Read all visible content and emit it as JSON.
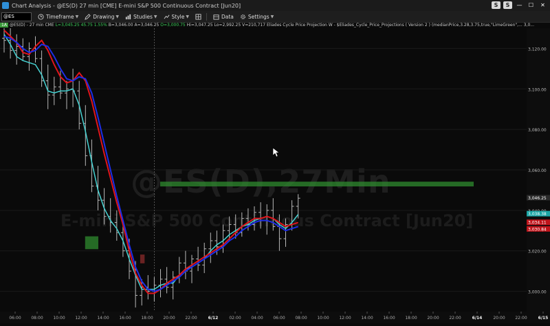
{
  "window": {
    "title": "Chart Analysis - @ES(D) 27 min [CME] E-mini S&P 500 Continuous Contract [Jun20]",
    "btn_s1": "S",
    "btn_s2": "S",
    "btn_min": "—",
    "btn_max": "☐",
    "btn_close": "✕"
  },
  "toolbar": {
    "symbol": "@ES",
    "timeframe": "Timeframe",
    "drawing": "Drawing",
    "studies": "Studies",
    "style": "Style",
    "data": "Data",
    "settings": "Settings"
  },
  "infobar": {
    "tag": "1A",
    "symbol": "@ES(D) - 27 min  CME",
    "last": "L=3,045.25",
    "change": "45.75",
    "pct": "1.55%",
    "bid": "B=3,046.00",
    "ask": "A=3,046.25",
    "open": "O=3,000.75",
    "high": "Hi=3,047.25",
    "low": "Lo=2,992.25",
    "volume": "V=210,717",
    "study": "Eliades Cycle Price Projection W - $Eliades_Cycle_Price_Projections ( Version 2 ) (medianPrice,3.28,3.75,true,\"LimeGreen\",... 3,0..."
  },
  "watermark": {
    "line1": "@ES(D),27Min",
    "line2": "E-mini S&P 500 Continuous Contract [Jun20]"
  },
  "colors": {
    "bars": "#b9b9b9",
    "cyan": "#46d3d3",
    "red": "#e0151c",
    "blue": "#1e2ee6",
    "zone_green": "#2f8a2f",
    "zone_red": "#8a2a2a"
  },
  "chart_data": {
    "type": "line",
    "title": "",
    "ylim": [
      2990,
      3130
    ],
    "yticks": [
      "3,120.00",
      "3,100.00",
      "3,080.00",
      "3,060.00",
      "3,040.00",
      "3,020.00",
      "3,000.00"
    ],
    "ytick_values": [
      3120,
      3100,
      3080,
      3060,
      3040,
      3020,
      3000
    ],
    "xticks": [
      "06:00",
      "08:00",
      "10:00",
      "12:00",
      "14:00",
      "16:00",
      "18:00",
      "20:00",
      "22:00",
      "6/12",
      "02:00",
      "04:00",
      "06:00",
      "08:00",
      "10:00",
      "12:00",
      "14:00",
      "16:00",
      "18:00",
      "20:00",
      "22:00",
      "6/14",
      "20:00",
      "22:00",
      "6/15"
    ],
    "price_labels": [
      {
        "text": "3,046.25",
        "value": 3046.25,
        "color": "#2a2a2a"
      },
      {
        "text": "3,038.38",
        "value": 3038.38,
        "color": "#1aa5a5"
      },
      {
        "text": "3,034.11",
        "value": 3034.11,
        "color": "#c0141b"
      },
      {
        "text": "3,030.84",
        "value": 3030.84,
        "color": "#c0141b"
      }
    ],
    "bars": [
      {
        "o": 3125,
        "h": 3131,
        "l": 3118,
        "c": 3124
      },
      {
        "o": 3124,
        "h": 3130,
        "l": 3115,
        "c": 3119
      },
      {
        "o": 3119,
        "h": 3127,
        "l": 3112,
        "c": 3121
      },
      {
        "o": 3121,
        "h": 3125,
        "l": 3114,
        "c": 3116
      },
      {
        "o": 3116,
        "h": 3123,
        "l": 3109,
        "c": 3120
      },
      {
        "o": 3120,
        "h": 3126,
        "l": 3113,
        "c": 3115
      },
      {
        "o": 3115,
        "h": 3119,
        "l": 3101,
        "c": 3104
      },
      {
        "o": 3104,
        "h": 3112,
        "l": 3090,
        "c": 3097
      },
      {
        "o": 3097,
        "h": 3106,
        "l": 3092,
        "c": 3101
      },
      {
        "o": 3101,
        "h": 3109,
        "l": 3095,
        "c": 3098
      },
      {
        "o": 3098,
        "h": 3104,
        "l": 3090,
        "c": 3100
      },
      {
        "o": 3100,
        "h": 3110,
        "l": 3091,
        "c": 3099
      },
      {
        "o": 3099,
        "h": 3104,
        "l": 3080,
        "c": 3083
      },
      {
        "o": 3083,
        "h": 3092,
        "l": 3062,
        "c": 3067
      },
      {
        "o": 3067,
        "h": 3075,
        "l": 3049,
        "c": 3052
      },
      {
        "o": 3052,
        "h": 3062,
        "l": 3040,
        "c": 3045
      },
      {
        "o": 3045,
        "h": 3051,
        "l": 3033,
        "c": 3037
      },
      {
        "o": 3037,
        "h": 3046,
        "l": 3029,
        "c": 3034
      },
      {
        "o": 3034,
        "h": 3040,
        "l": 3025,
        "c": 3029
      },
      {
        "o": 3029,
        "h": 3033,
        "l": 3017,
        "c": 3020
      },
      {
        "o": 3020,
        "h": 3026,
        "l": 3006,
        "c": 3010
      },
      {
        "o": 3010,
        "h": 3015,
        "l": 2992,
        "c": 2998
      },
      {
        "o": 2998,
        "h": 3006,
        "l": 2993,
        "c": 3002
      },
      {
        "o": 3002,
        "h": 3008,
        "l": 2996,
        "c": 3000
      },
      {
        "o": 3000,
        "h": 3007,
        "l": 2995,
        "c": 3003
      },
      {
        "o": 3003,
        "h": 3011,
        "l": 2997,
        "c": 3006
      },
      {
        "o": 3006,
        "h": 3012,
        "l": 2999,
        "c": 3002
      },
      {
        "o": 3002,
        "h": 3010,
        "l": 2996,
        "c": 3007
      },
      {
        "o": 3007,
        "h": 3017,
        "l": 3004,
        "c": 3014
      },
      {
        "o": 3014,
        "h": 3020,
        "l": 3006,
        "c": 3010
      },
      {
        "o": 3010,
        "h": 3018,
        "l": 3004,
        "c": 3016
      },
      {
        "o": 3016,
        "h": 3022,
        "l": 3010,
        "c": 3013
      },
      {
        "o": 3013,
        "h": 3024,
        "l": 3009,
        "c": 3021
      },
      {
        "o": 3021,
        "h": 3029,
        "l": 3014,
        "c": 3025
      },
      {
        "o": 3025,
        "h": 3030,
        "l": 3018,
        "c": 3022
      },
      {
        "o": 3022,
        "h": 3033,
        "l": 3019,
        "c": 3030
      },
      {
        "o": 3030,
        "h": 3037,
        "l": 3025,
        "c": 3033
      },
      {
        "o": 3033,
        "h": 3038,
        "l": 3026,
        "c": 3029
      },
      {
        "o": 3029,
        "h": 3039,
        "l": 3027,
        "c": 3036
      },
      {
        "o": 3036,
        "h": 3041,
        "l": 3030,
        "c": 3033
      },
      {
        "o": 3033,
        "h": 3042,
        "l": 3030,
        "c": 3039
      },
      {
        "o": 3039,
        "h": 3044,
        "l": 3031,
        "c": 3035
      },
      {
        "o": 3035,
        "h": 3043,
        "l": 3028,
        "c": 3040
      },
      {
        "o": 3040,
        "h": 3046,
        "l": 3030,
        "c": 3032
      },
      {
        "o": 3032,
        "h": 3038,
        "l": 3020,
        "c": 3026
      },
      {
        "o": 3026,
        "h": 3036,
        "l": 3022,
        "c": 3033
      },
      {
        "o": 3033,
        "h": 3045,
        "l": 3030,
        "c": 3042
      },
      {
        "o": 3042,
        "h": 3048,
        "l": 3036,
        "c": 3046
      }
    ],
    "series": [
      {
        "key": "cyan",
        "values": [
          3127,
          3122,
          3116,
          3114,
          3113,
          3112,
          3107,
          3099,
          3098,
          3099,
          3099,
          3100,
          3092,
          3079,
          3064,
          3050,
          3041,
          3035,
          3031,
          3025,
          3016,
          3008,
          3001,
          3001,
          3001,
          3003,
          3004,
          3004,
          3008,
          3011,
          3012,
          3014,
          3016,
          3020,
          3023,
          3025,
          3028,
          3030,
          3032,
          3033,
          3035,
          3036,
          3037,
          3036,
          3033,
          3031,
          3034,
          3038
        ]
      },
      {
        "key": "red",
        "values": [
          3129,
          3126,
          3123,
          3118,
          3117,
          3121,
          3124,
          3119,
          3112,
          3106,
          3103,
          3104,
          3108,
          3104,
          3094,
          3081,
          3068,
          3056,
          3044,
          3033,
          3020,
          3009,
          3003,
          2999,
          2999,
          3001,
          3004,
          3006,
          3008,
          3011,
          3013,
          3015,
          3017,
          3019,
          3021,
          3023,
          3026,
          3029,
          3032,
          3034,
          3036,
          3036,
          3037,
          3036,
          3034,
          3032,
          3033,
          3034
        ]
      },
      {
        "key": "blue",
        "values": [
          3126,
          3125,
          3123,
          3120,
          3118,
          3119,
          3122,
          3121,
          3116,
          3110,
          3105,
          3104,
          3106,
          3105,
          3098,
          3086,
          3073,
          3060,
          3047,
          3035,
          3023,
          3012,
          3005,
          3001,
          3000,
          3001,
          3003,
          3005,
          3007,
          3010,
          3012,
          3014,
          3016,
          3018,
          3020,
          3022,
          3025,
          3027,
          3030,
          3032,
          3034,
          3035,
          3035,
          3034,
          3032,
          3030,
          3031,
          3032
        ]
      }
    ],
    "zones": [
      {
        "color": "green",
        "x0": 25,
        "x1": 75,
        "y0": 3054,
        "y1": 3052
      },
      {
        "color": "green",
        "x0": 13,
        "x1": 15,
        "y0": 3027,
        "y1": 3021
      },
      {
        "color": "red",
        "x0": 21.8,
        "x1": 22.4,
        "y0": 3018,
        "y1": 3014
      }
    ]
  }
}
